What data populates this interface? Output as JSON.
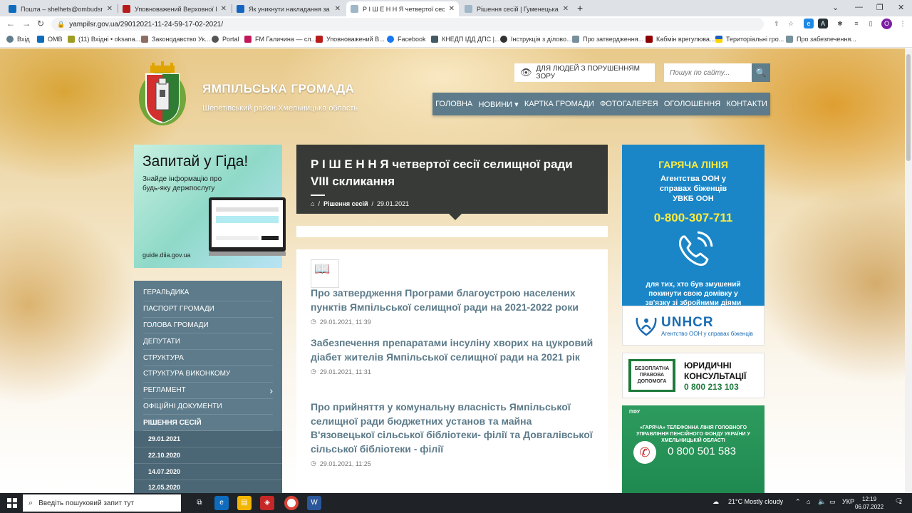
{
  "browser": {
    "tabs": [
      {
        "title": "Пошта – shelhets@ombudsman",
        "color": "#0f6cbd"
      },
      {
        "title": "Уповноважений Верховної Рад",
        "color": "#b71c1c"
      },
      {
        "title": "Як уникнути накладання за вбивс",
        "color": "#1565c0"
      },
      {
        "title": "Р І Ш Е Н Н Я четвертої сесії сел",
        "color": "#9fb7c7"
      },
      {
        "title": "Рішення сесій | Гуменецька сіль",
        "color": "#9fb7c7"
      }
    ],
    "url": "yampilsr.gov.ua/29012021-11-24-59-17-02-2021/",
    "profile_initial": "O",
    "bookmarks": [
      "Вхід",
      "OMB",
      "(11) Вхідні • oksana...",
      "Законодавство Ук...",
      "Portal",
      "FM Галичина — сл...",
      "Уповноважений В...",
      "Facebook",
      "КНЕДП ІДД ДПС |...",
      "Інструкція з діловo...",
      "Про затвердження...",
      "Кабмін врегулюва...",
      "Територіальні гро...",
      "Про забезпечення..."
    ]
  },
  "site": {
    "title": "ЯМПІЛЬСЬКА ГРОМАДА",
    "subtitle": "Шепетівський район Хмельницька область",
    "vision_label": "ДЛЯ ЛЮДЕЙ З ПОРУШЕННЯМ ЗОРУ",
    "search_placeholder": "Пошук по сайту..."
  },
  "mainnav": [
    "ГОЛОВНА",
    "НОВИНИ ▾",
    "КАРТКА ГРОМАДИ",
    "ФОТОГАЛЕРЕЯ",
    "ОГОЛОШЕННЯ",
    "КОНТАКТИ"
  ],
  "diia": {
    "heading": "Запитай у Гіда!",
    "text": "Знайде інформацію про будь-яку держпослугу",
    "url": "guide.diia.gov.ua"
  },
  "leftnav": [
    {
      "label": "ГЕРАЛЬДИКА"
    },
    {
      "label": "ПАСПОРТ ГРОМАДИ"
    },
    {
      "label": "ГОЛОВА ГРОМАДИ"
    },
    {
      "label": "ДЕПУТАТИ"
    },
    {
      "label": "СТРУКТУРА"
    },
    {
      "label": "СТРУКТУРА ВИКОНКОМУ"
    },
    {
      "label": "РЕГЛАМЕНТ",
      "arrow": "›"
    },
    {
      "label": "ОФІЦІЙНІ ДОКУМЕНТИ"
    },
    {
      "label": "РІШЕННЯ СЕСІЙ"
    },
    {
      "label": "29.01.2021"
    },
    {
      "label": "22.10.2020"
    },
    {
      "label": "14.07.2020"
    },
    {
      "label": "12.05.2020"
    }
  ],
  "article": {
    "title": "Р І Ш Е Н Н Я четвертої сесії селищної ради VIII скликання",
    "crumb_section": "Рішення сесій",
    "crumb_date": "29.01.2021"
  },
  "posts": [
    {
      "title": "Про затвердження Програми благоустрою населених пунктів Ямпільської селищної ради на 2021-2022 роки",
      "date": "29.01.2021, 11:39"
    },
    {
      "title": "Забезпечення препаратами інсуліну хворих на цукровий діабет жителів  Ямпільської селищної ради на 2021 рік",
      "date": "29.01.2021, 11:31"
    },
    {
      "title": "Про прийняття у комунальну власність Ямпільської селищної ради бюджетних установ та майна  В'язовецької сільської бібліотеки- філії та Довгалівської сільської бібліотеки - філії",
      "date": "29.01.2021, 11:25"
    }
  ],
  "hotline": {
    "heading": "ГАРЯЧА ЛІНІЯ",
    "agency": "Агентства ООН у справах біженців УВКБ ООН",
    "phone": "0-800-307-711",
    "note": "для тих, хто був змушений покинути свою домівку у зв'язку зі збройними діями"
  },
  "unhcr": {
    "name": "UNHCR",
    "tagline": "Агентство ООН у справах біженців"
  },
  "legal": {
    "badge": "БЕЗОПЛАТНА ПРАВОВА ДОПОМОГА",
    "title": "ЮРИДИЧНІ КОНСУЛЬТАЦІЇ",
    "phone": "0 800 213 103"
  },
  "pfu": {
    "logo": "ПФУ",
    "heading": "«ГАРЯЧА» ТЕЛЕФОННА ЛІНІЯ ГОЛОВНОГО УПРАВЛІННЯ ПЕНСІЙНОГО ФОНДУ УКРАЇНИ У ХМЕЛЬНИЦЬКІЙ ОБЛАСТІ",
    "phone": "0 800 501 583"
  },
  "taskbar": {
    "search_placeholder": "Введіть пошуковий запит тут",
    "weather": "21°C  Mostly cloudy",
    "lang": "УКР",
    "time": "12:19",
    "date": "06.07.2022",
    "notifications": "2"
  },
  "colors": {
    "accent": "#5d7b8a",
    "hotline": "#1a86c7",
    "green": "#1e7a3a"
  }
}
